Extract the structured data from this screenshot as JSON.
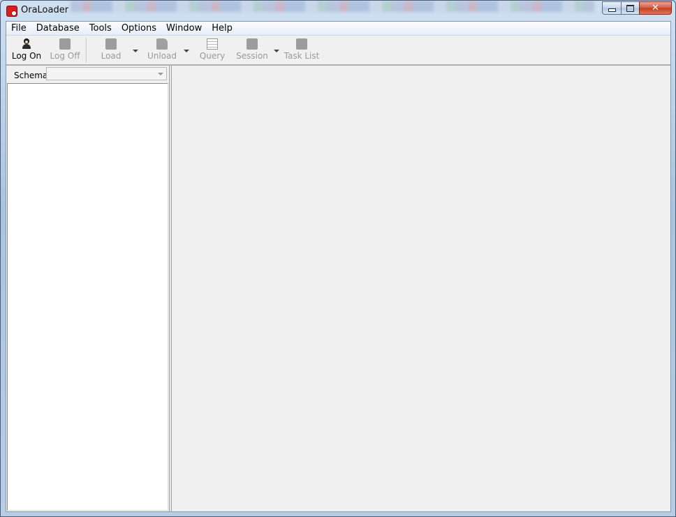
{
  "window": {
    "title": "OraLoader"
  },
  "menu": [
    "File",
    "Database",
    "Tools",
    "Options",
    "Window",
    "Help"
  ],
  "toolbar": {
    "logon": "Log On",
    "logoff": "Log Off",
    "load": "Load",
    "unload": "Unload",
    "query": "Query",
    "session": "Session",
    "tasklist": "Task List"
  },
  "leftpane": {
    "schema_label": "Schema",
    "schema_value": ""
  },
  "icons": {
    "app": "oraloader-app-icon",
    "logon": "user-icon",
    "logoff": "user-off-icon",
    "load": "load-icon",
    "unload": "unload-icon",
    "query": "query-icon",
    "session": "session-icon",
    "tasklist": "task-list-icon"
  },
  "colors": {
    "app_icon": "#d42020",
    "disabled_text": "#9a9a9a",
    "workspace": "#f0f0f0"
  }
}
